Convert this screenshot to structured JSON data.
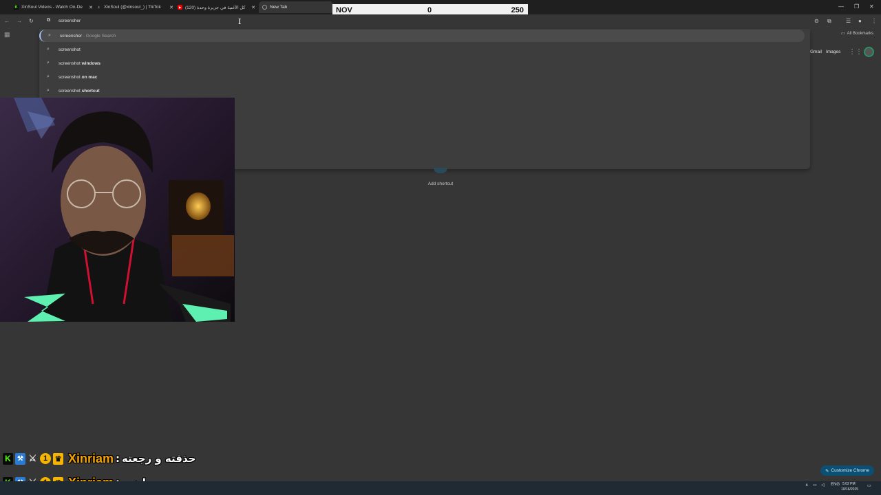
{
  "browser": {
    "tabs": [
      {
        "title": "XinSoul Videos - Watch On-De",
        "favicon": "kick-icon",
        "favicon_color": "#53fc18"
      },
      {
        "title": "XinSoul (@xinsoul_) | TikTok",
        "favicon": "tiktok-icon",
        "favicon_color": "#ffffff"
      },
      {
        "title": "(120) كل الأغنية في جزيرة وحدة",
        "favicon": "youtube-icon",
        "favicon_color": "#ff0000"
      },
      {
        "title": "New Tab",
        "favicon": "chrome-icon",
        "favicon_color": "#9a9a9a"
      }
    ],
    "omnibox_text": "screensher",
    "all_bookmarks_label": "All Bookmarks",
    "suggestions": [
      {
        "typed": "screensher",
        "suffix": " - Google Search"
      },
      {
        "prefix": "screenshot",
        "rest": ""
      },
      {
        "prefix": "screenshot",
        "rest": " windows"
      },
      {
        "prefix": "screenshot",
        "rest": " on mac"
      },
      {
        "prefix": "screenshot",
        "rest": " shortcut"
      }
    ]
  },
  "overlay_counter": {
    "label": "NOV",
    "current": "0",
    "target": "250"
  },
  "ntp": {
    "gmail": "Gmail",
    "images": "Images",
    "add_shortcut": "Add shortcut",
    "customize": "Customize Chrome"
  },
  "chat": [
    {
      "user": "Xinriam",
      "message": "حذفته و رجعته"
    },
    {
      "user": "Xinriam",
      "message": "مو راضي"
    }
  ],
  "taskbar": {
    "language": "ENG",
    "time": "5:02 PM",
    "date": "10/16/2025"
  },
  "colors": {
    "accent": "#a8c7fa",
    "kick_green": "#53fc18",
    "username": "#f5a300"
  }
}
